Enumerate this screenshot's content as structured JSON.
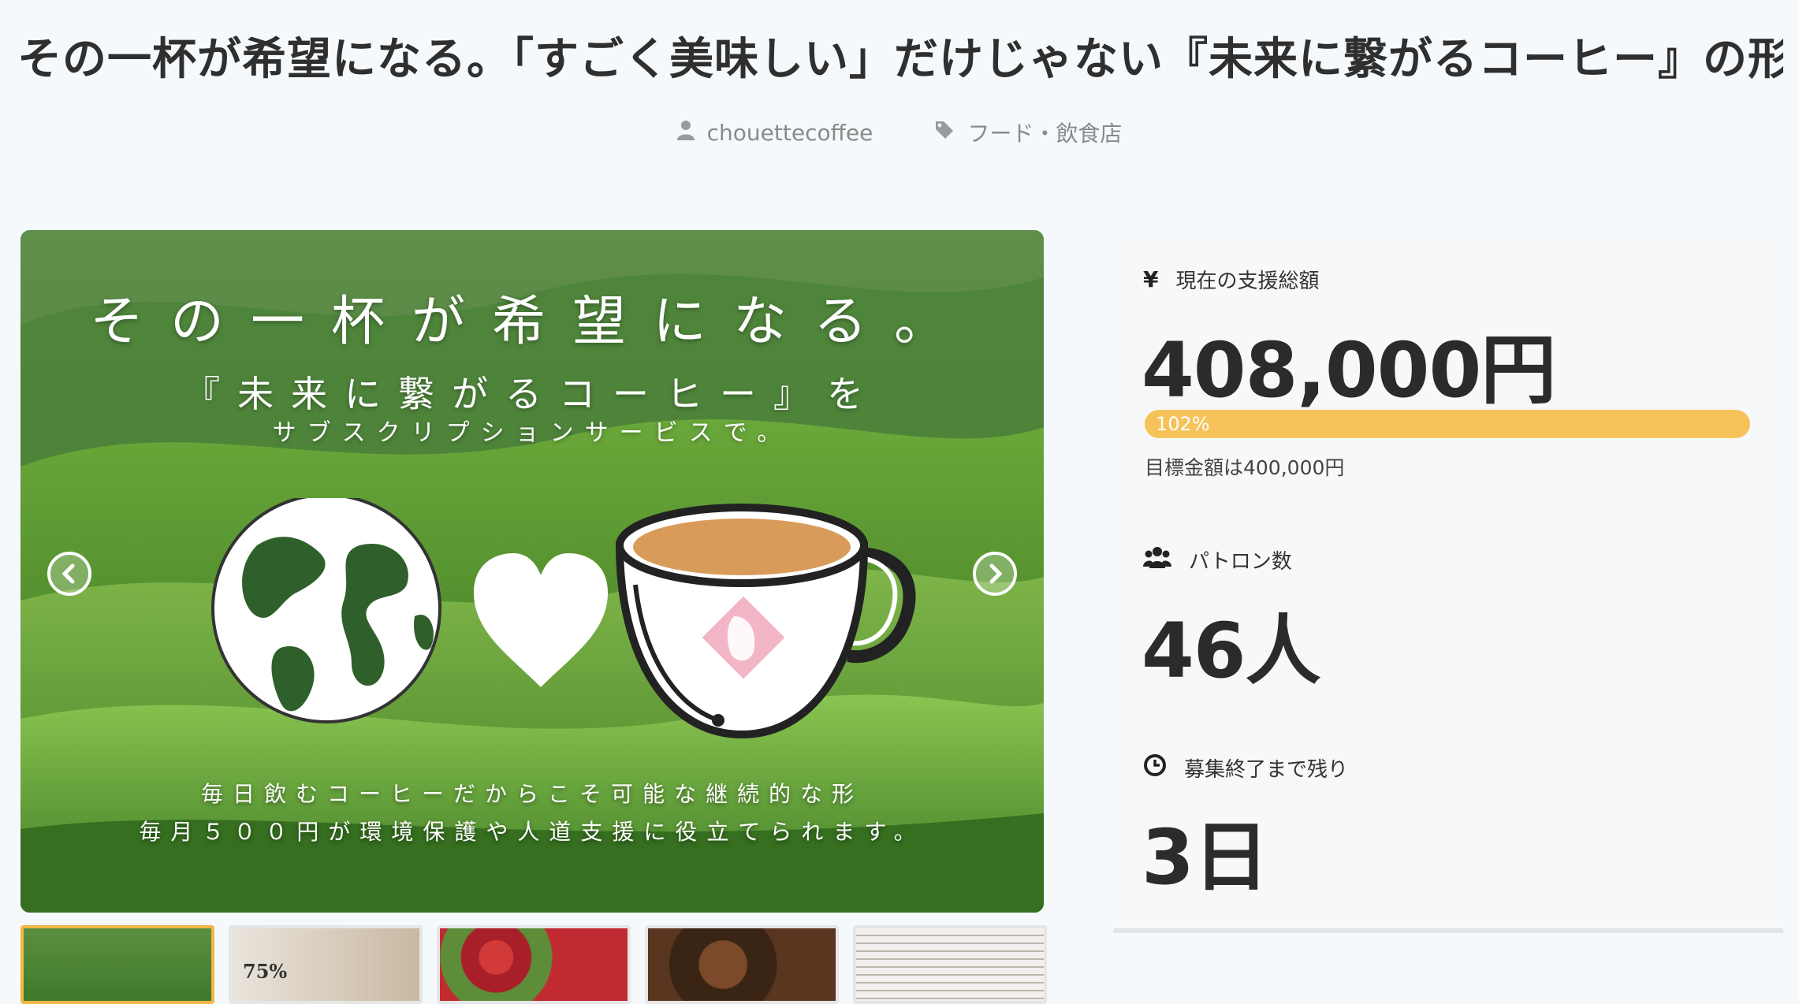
{
  "page": {
    "title": "その一杯が希望になる。「すごく美味しい」だけじゃない『未来に繋がるコーヒー』の形"
  },
  "meta": {
    "author": "chouettecoffee",
    "category": "フード・飲食店"
  },
  "slide": {
    "headline": "その一杯が希望になる。",
    "sub1": "『未来に繋がるコーヒー』を",
    "sub2": "サブスクリプションサービスで。",
    "bottom1": "毎日飲むコーヒーだからこそ可能な継続的な形",
    "bottom2": "毎月５００円が環境保護や人道支援に役立てられます。"
  },
  "thumbnails": [
    {
      "label": "",
      "active": true
    },
    {
      "label": "75%",
      "active": false
    },
    {
      "label": "",
      "active": false
    },
    {
      "label": "",
      "active": false
    },
    {
      "label": "",
      "active": false
    }
  ],
  "stats": {
    "total_label": "現在の支援総額",
    "total_value": "408,000円",
    "progress_text": "102%",
    "progress_fraction": 1.02,
    "goal_text": "目標金額は400,000円",
    "patrons_label": "パトロン数",
    "patrons_value": "46人",
    "remaining_label": "募集終了まで残り",
    "remaining_value": "3日"
  },
  "icons": {
    "author": "user-icon",
    "category": "tag-icon",
    "total": "yen-icon",
    "patrons": "users-icon",
    "remaining": "clock-icon",
    "prev": "chevron-left-icon",
    "next": "chevron-right-icon"
  },
  "colors": {
    "progress": "#f6c35a",
    "thumb_active": "#f3b545",
    "background": "#f5f9fc"
  }
}
